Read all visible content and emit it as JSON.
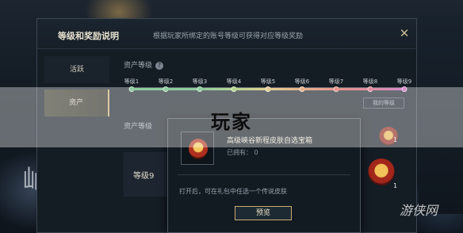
{
  "dialog": {
    "title": "等级和奖励说明",
    "subtitle": "根据玩家所绑定的账号等级可获得对应等级奖励",
    "close_glyph": "✕"
  },
  "sidebar": {
    "items": [
      {
        "label": "活跃",
        "active": false
      },
      {
        "label": "资产",
        "active": true
      }
    ]
  },
  "asset_section": {
    "label": "资产等级",
    "help_glyph": "?",
    "levels": [
      "等级1",
      "等级2",
      "等级3",
      "等级4",
      "等级5",
      "等级6",
      "等级7",
      "等级8",
      "等级9"
    ],
    "level_colors": [
      "#4fb06a",
      "#4fb06a",
      "#4fb06a",
      "#8dbf55",
      "#d3b454",
      "#d8874c",
      "#d85a4a",
      "#cc4e6a",
      "#c04bb0"
    ],
    "my_level_chip": "我的等级"
  },
  "asset_section_2": {
    "label": "资产等级"
  },
  "level_card": {
    "label": "等级9"
  },
  "rewards": {
    "count": "1",
    "count_far": "1"
  },
  "popup": {
    "title": "高级峡谷新程皮肤自选宝箱",
    "owned": "已拥有： 0",
    "description": "打开后，可在礼包中任选一个传说皮肤",
    "preview_button": "预览"
  },
  "banner": {
    "text": "玩家"
  },
  "watermark": "游侠网"
}
